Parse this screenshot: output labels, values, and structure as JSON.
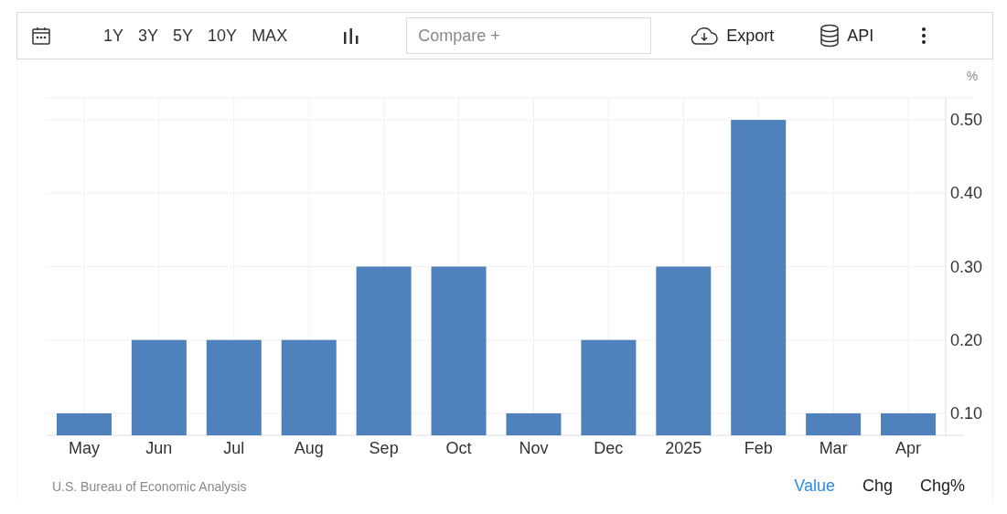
{
  "toolbar": {
    "ranges": [
      "1Y",
      "3Y",
      "5Y",
      "10Y",
      "MAX"
    ],
    "compare": {
      "placeholder": "Compare +"
    },
    "export": "Export",
    "api": "API"
  },
  "chart": {
    "unit": "%",
    "chart_data": {
      "type": "bar",
      "categories": [
        "May",
        "Jun",
        "Jul",
        "Aug",
        "Sep",
        "Oct",
        "Nov",
        "Dec",
        "2025",
        "Feb",
        "Mar",
        "Apr"
      ],
      "series": [
        {
          "color": "#4f81bd",
          "values": [
            0.1,
            0.2,
            0.2,
            0.2,
            0.3,
            0.3,
            0.1,
            0.2,
            0.3,
            0.5,
            0.1,
            0.1
          ]
        }
      ],
      "ylim": [
        0.07,
        0.53
      ],
      "grid": true,
      "yticks": [
        {
          "value": 0.1,
          "label": "0.10"
        },
        {
          "value": 0.2,
          "label": "0.20"
        },
        {
          "value": 0.3,
          "label": "0.30"
        },
        {
          "value": 0.4,
          "label": "0.40"
        },
        {
          "value": 0.5,
          "label": "0.50"
        }
      ]
    }
  },
  "footer": {
    "source": "U.S. Bureau of Economic Analysis",
    "modes": [
      {
        "label": "Value",
        "selected": true
      },
      {
        "label": "Chg",
        "selected": false
      },
      {
        "label": "Chg%",
        "selected": false
      }
    ]
  }
}
